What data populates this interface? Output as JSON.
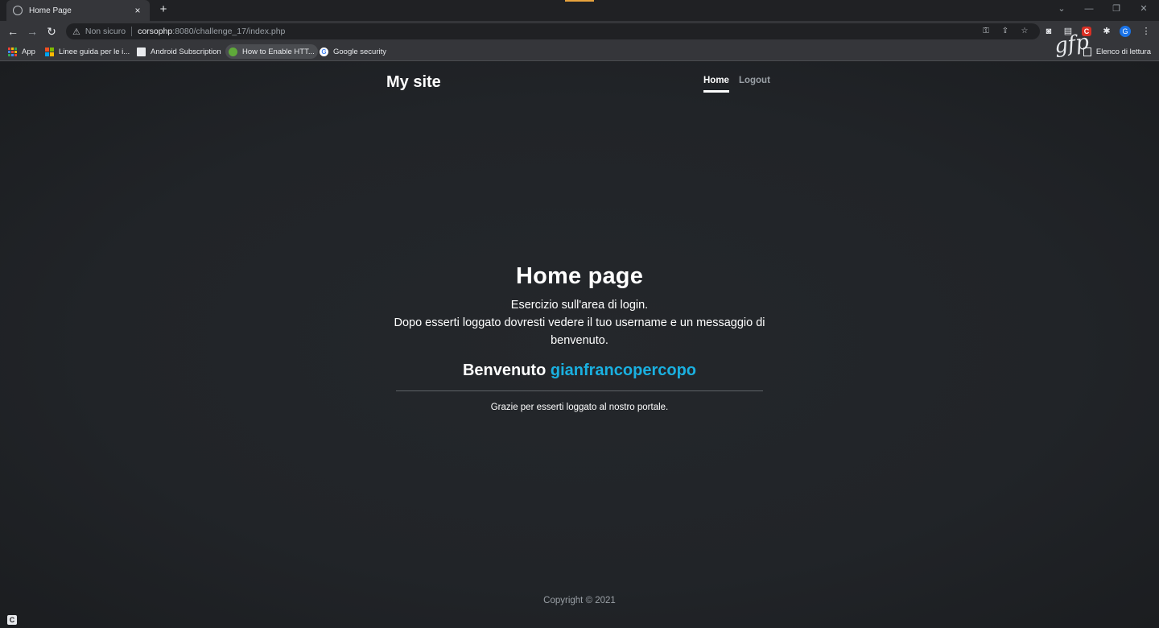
{
  "browser": {
    "tab_title": "Home Page",
    "tab_close": "×",
    "new_tab": "+",
    "security_label": "Non sicuro",
    "url_host": "corsophp",
    "url_rest": ":8080/challenge_17/index.php",
    "extension_badge": "C",
    "avatar_letter": "G",
    "bookmarks": {
      "apps": "App",
      "linee": "Linee guida per le i...",
      "android": "Android Subscription",
      "https": "How to Enable HTT...",
      "google": "Google security",
      "reading_list": "Elenco di lettura"
    },
    "watermark": "gfp"
  },
  "site": {
    "brand": "My site",
    "nav": {
      "home": "Home",
      "logout": "Logout"
    },
    "title": "Home page",
    "intro_line1": "Esercizio sull'area di login.",
    "intro_line2": "Dopo esserti loggato dovresti vedere il tuo username e un messaggio di benvenuto.",
    "welcome_prefix": "Benvenuto ",
    "username": "gianfrancopercopo",
    "thanks": "Grazie per esserti loggato al nostro portale.",
    "footer": "Copyright © 2021"
  },
  "colors": {
    "accent": "#1ab0e0",
    "background": "#212428"
  },
  "status_badge": "C"
}
